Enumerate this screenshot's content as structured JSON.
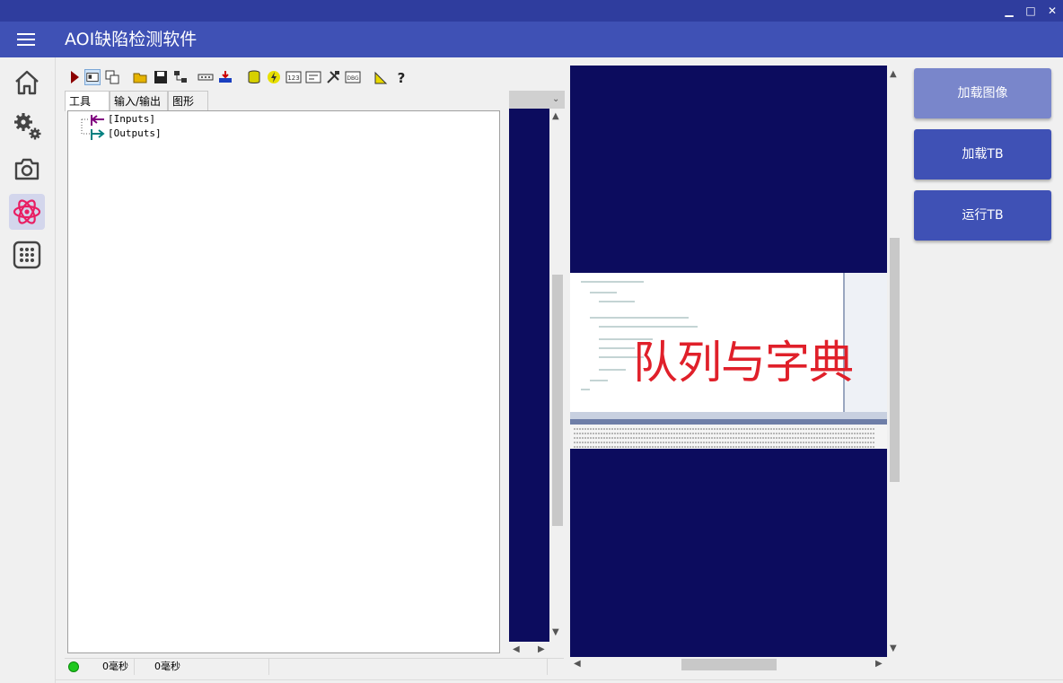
{
  "window": {
    "minimize": "▁",
    "maximize": "□",
    "close": "✕"
  },
  "app": {
    "title": "AOI缺陷检测软件"
  },
  "sidebar": {
    "items": [
      {
        "name": "home",
        "icon": "home-icon"
      },
      {
        "name": "settings",
        "icon": "gears-icon"
      },
      {
        "name": "camera",
        "icon": "camera-icon"
      },
      {
        "name": "atom",
        "icon": "atom-icon",
        "active": true
      },
      {
        "name": "apps",
        "icon": "grid-icon"
      }
    ],
    "active_color": "#e91e63"
  },
  "tool_panel": {
    "tabs": [
      "工具",
      "输入/输出",
      "图形"
    ],
    "tree": [
      "[Inputs]",
      "[Outputs]"
    ],
    "status": {
      "time1": "0毫秒",
      "time2": "0毫秒"
    }
  },
  "viewer": {
    "overlay_text": "队列与字典",
    "overlay_color": "#e0202a",
    "background": "#0c0c5e"
  },
  "actions": {
    "load_image": "加载图像",
    "load_tb": "加载TB",
    "run_tb": "运行TB"
  },
  "colors": {
    "primary": "#3f51b5",
    "primary_dark": "#2f3d9e",
    "disabled": "#7986cb"
  }
}
